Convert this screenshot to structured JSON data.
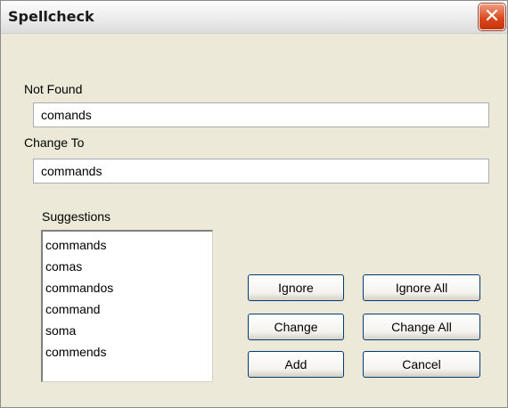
{
  "window": {
    "title": "Spellcheck",
    "close_symbol": "✕"
  },
  "not_found": {
    "label": "Not Found",
    "value": "comands"
  },
  "change_to": {
    "label": "Change To",
    "value": "commands"
  },
  "suggestions": {
    "label": "Suggestions",
    "items": [
      "commands",
      "comas",
      "commandos",
      "command",
      "soma",
      "commends"
    ]
  },
  "buttons": {
    "ignore": "Ignore",
    "ignore_all": "Ignore All",
    "change": "Change",
    "change_all": "Change All",
    "add": "Add",
    "cancel": "Cancel"
  },
  "colors": {
    "dialog_bg": "#ece9d8",
    "close_button": "#d9451b",
    "button_border": "#003c74"
  }
}
